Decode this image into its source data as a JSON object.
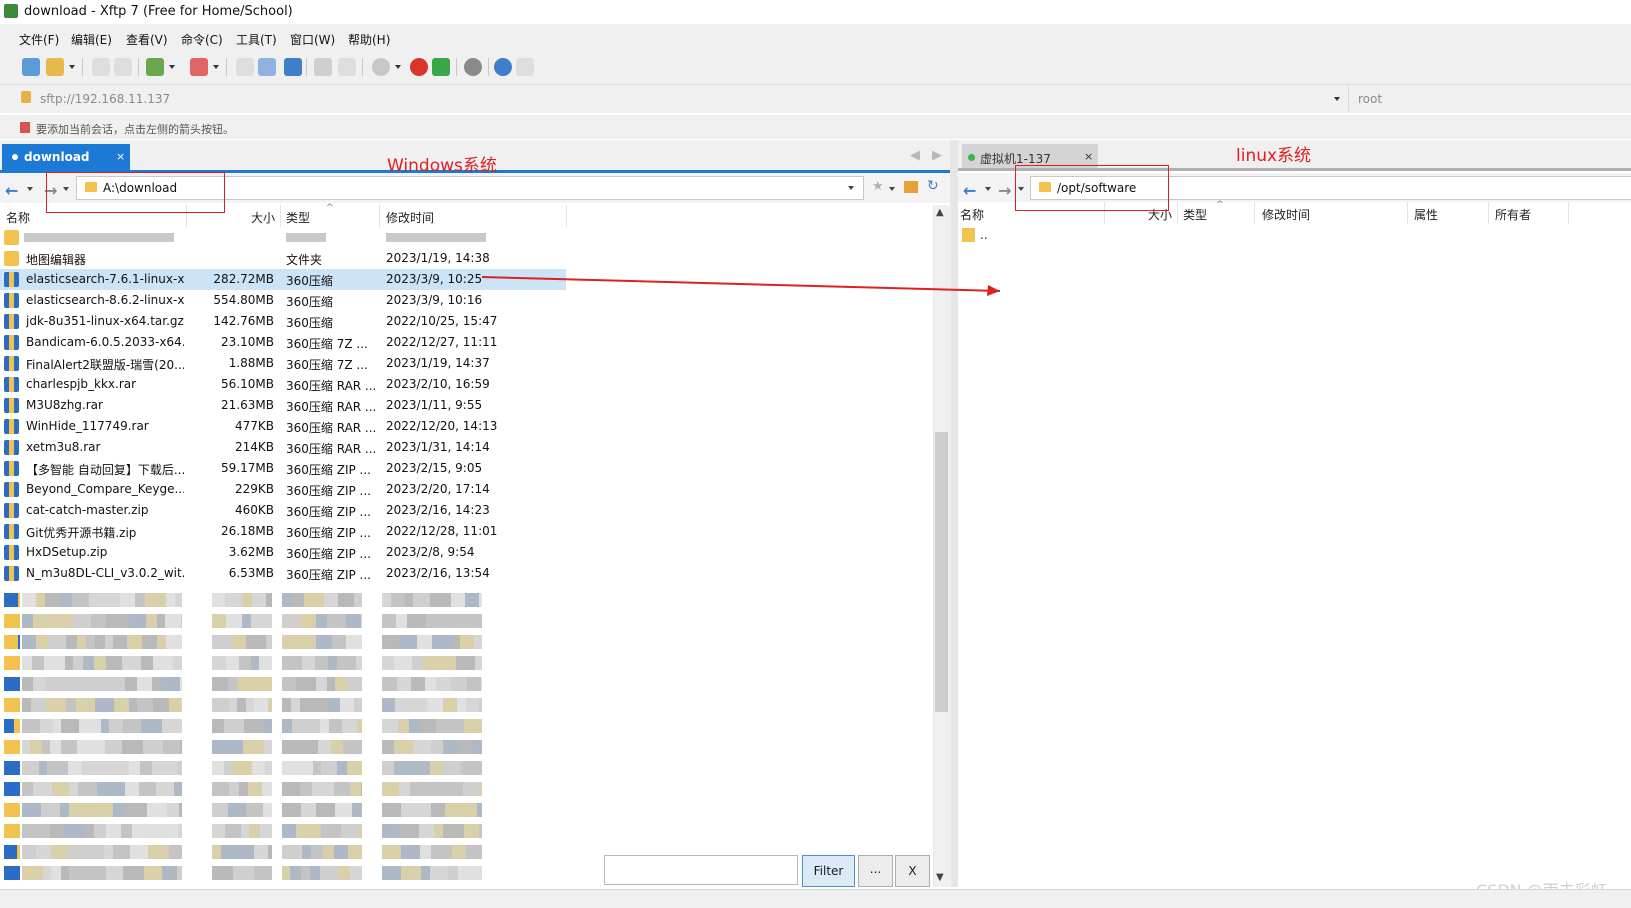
{
  "window": {
    "title": "download - Xftp 7 (Free for Home/School)"
  },
  "menu": [
    "文件(F)",
    "编辑(E)",
    "查看(V)",
    "命令(C)",
    "工具(T)",
    "窗口(W)",
    "帮助(H)"
  ],
  "address": {
    "url": "sftp://192.168.11.137",
    "user_placeholder": "root"
  },
  "hint": "要添加当前会话，点击左侧的箭头按钮。",
  "tabs": {
    "left": {
      "label": "download",
      "close": "×"
    },
    "right": {
      "label": "虚拟机1-137",
      "close": "×"
    }
  },
  "left_pane": {
    "path": "A:\\download",
    "columns": {
      "name": "名称",
      "size": "大小",
      "type": "类型",
      "modified": "修改时间"
    },
    "rows": [
      {
        "name": "地图编辑器",
        "size": "",
        "type": "文件夹",
        "modified": "2023/1/19, 14:38",
        "kind": "folder"
      },
      {
        "name": "elasticsearch-7.6.1-linux-x...",
        "size": "282.72MB",
        "type": "360压缩",
        "modified": "2023/3/9, 10:25",
        "kind": "zip",
        "selected": true
      },
      {
        "name": "elasticsearch-8.6.2-linux-x...",
        "size": "554.80MB",
        "type": "360压缩",
        "modified": "2023/3/9, 10:16",
        "kind": "zip"
      },
      {
        "name": "jdk-8u351-linux-x64.tar.gz",
        "size": "142.76MB",
        "type": "360压缩",
        "modified": "2022/10/25, 15:47",
        "kind": "zip"
      },
      {
        "name": "Bandicam-6.0.5.2033-x64....",
        "size": "23.10MB",
        "type": "360压缩 7Z ...",
        "modified": "2022/12/27, 11:11",
        "kind": "zip"
      },
      {
        "name": "FinalAlert2联盟版-瑞雪(20...",
        "size": "1.88MB",
        "type": "360压缩 7Z ...",
        "modified": "2023/1/19, 14:37",
        "kind": "zip"
      },
      {
        "name": "charlespjb_kkx.rar",
        "size": "56.10MB",
        "type": "360压缩 RAR ...",
        "modified": "2023/2/10, 16:59",
        "kind": "zip"
      },
      {
        "name": "M3U8zhg.rar",
        "size": "21.63MB",
        "type": "360压缩 RAR ...",
        "modified": "2023/1/11, 9:55",
        "kind": "zip"
      },
      {
        "name": "WinHide_117749.rar",
        "size": "477KB",
        "type": "360压缩 RAR ...",
        "modified": "2022/12/20, 14:13",
        "kind": "zip"
      },
      {
        "name": "xetm3u8.rar",
        "size": "214KB",
        "type": "360压缩 RAR ...",
        "modified": "2023/1/31, 14:14",
        "kind": "zip"
      },
      {
        "name": "【多智能 自动回复】下载后...",
        "size": "59.17MB",
        "type": "360压缩 ZIP ...",
        "modified": "2023/2/15, 9:05",
        "kind": "zip"
      },
      {
        "name": "Beyond_Compare_Keyge...",
        "size": "229KB",
        "type": "360压缩 ZIP ...",
        "modified": "2023/2/20, 17:14",
        "kind": "zip"
      },
      {
        "name": "cat-catch-master.zip",
        "size": "460KB",
        "type": "360压缩 ZIP ...",
        "modified": "2023/2/16, 14:23",
        "kind": "zip"
      },
      {
        "name": "Git优秀开源书籍.zip",
        "size": "26.18MB",
        "type": "360压缩 ZIP ...",
        "modified": "2022/12/28, 11:01",
        "kind": "zip"
      },
      {
        "name": "HxDSetup.zip",
        "size": "3.62MB",
        "type": "360压缩 ZIP ...",
        "modified": "2023/2/8, 9:54",
        "kind": "zip"
      },
      {
        "name": "N_m3u8DL-CLI_v3.0.2_wit...",
        "size": "6.53MB",
        "type": "360压缩 ZIP ...",
        "modified": "2023/2/16, 13:54",
        "kind": "zip"
      }
    ],
    "filter": {
      "value": "",
      "filter_label": "Filter",
      "more_label": "...",
      "close_label": "X"
    }
  },
  "right_pane": {
    "path": "/opt/software",
    "columns": {
      "name": "名称",
      "size": "大小",
      "type": "类型",
      "modified": "修改时间",
      "attrs": "属性",
      "owner": "所有者"
    },
    "rows": [
      {
        "name": "..",
        "kind": "folder"
      }
    ]
  },
  "annotations": {
    "windows_label": "Windows系统",
    "linux_label": "linux系统",
    "color": "#e02020"
  },
  "watermark": "CSDN @雨去彩虹",
  "colors": {
    "accent": "#1c79d6",
    "selection": "#cce4f7",
    "folder": "#f2c24e"
  }
}
